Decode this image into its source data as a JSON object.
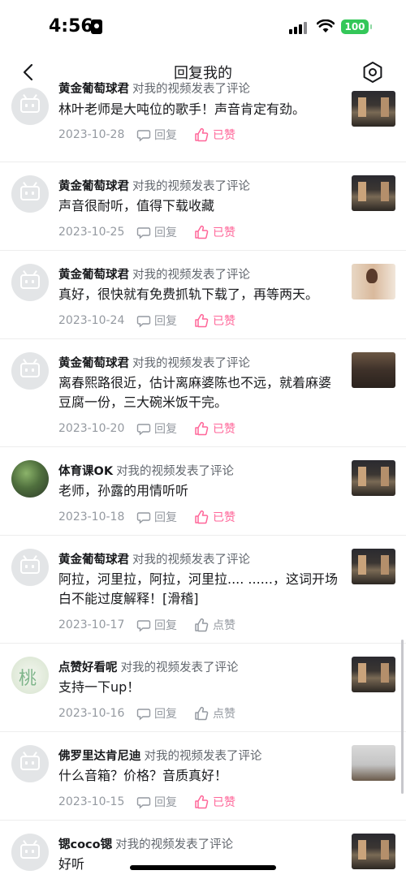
{
  "status_bar": {
    "time": "4:56",
    "battery": "100",
    "battery_color": "#34c759"
  },
  "nav": {
    "title": "回复我的",
    "back_icon": "chevron-left-icon",
    "settings_icon": "hexagon-gear-icon"
  },
  "colors": {
    "liked": "#ff6699",
    "muted": "#9499a0",
    "text": "#18191c"
  },
  "items": [
    {
      "user": "黄金葡萄球君",
      "action": "对我的视频发表了评论",
      "content": "林叶老师是大吨位的歌手！声音肯定有劲。",
      "date": "2023-10-28",
      "reply_label": "回复",
      "like_label": "已赞",
      "liked": true
    },
    {
      "user": "黄金葡萄球君",
      "action": "对我的视频发表了评论",
      "content": "声音很耐听，值得下载收藏",
      "date": "2023-10-25",
      "reply_label": "回复",
      "like_label": "已赞",
      "liked": true
    },
    {
      "user": "黄金葡萄球君",
      "action": "对我的视频发表了评论",
      "content": "真好，很快就有免费抓轨下载了，再等两天。",
      "date": "2023-10-24",
      "reply_label": "回复",
      "like_label": "已赞",
      "liked": true
    },
    {
      "user": "黄金葡萄球君",
      "action": "对我的视频发表了评论",
      "content": "离春熙路很近，估计离麻婆陈也不远，就着麻婆豆腐一份，三大碗米饭干完。",
      "date": "2023-10-20",
      "reply_label": "回复",
      "like_label": "已赞",
      "liked": true
    },
    {
      "user": "体育课OK",
      "action": "对我的视频发表了评论",
      "content": "老师，孙露的用情听听",
      "date": "2023-10-18",
      "reply_label": "回复",
      "like_label": "已赞",
      "liked": true
    },
    {
      "user": "黄金葡萄球君",
      "action": "对我的视频发表了评论",
      "content": "阿拉，河里拉，阿拉，河里拉.... ......，这词开场白不能过度解释！[滑稽]",
      "date": "2023-10-17",
      "reply_label": "回复",
      "like_label": "点赞",
      "liked": false
    },
    {
      "user": "点赞好看呢",
      "action": "对我的视频发表了评论",
      "content": "支持一下up！",
      "date": "2023-10-16",
      "reply_label": "回复",
      "like_label": "点赞",
      "liked": false
    },
    {
      "user": "佛罗里达肯尼迪",
      "action": "对我的视频发表了评论",
      "content": "什么音箱？价格？音质真好！",
      "date": "2023-10-15",
      "reply_label": "回复",
      "like_label": "已赞",
      "liked": true
    },
    {
      "user": "锶coco锶",
      "action": "对我的视频发表了评论",
      "content": "好听",
      "date": "",
      "reply_label": "",
      "like_label": "",
      "liked": false
    }
  ],
  "floral_avatar_glyph": "桃"
}
